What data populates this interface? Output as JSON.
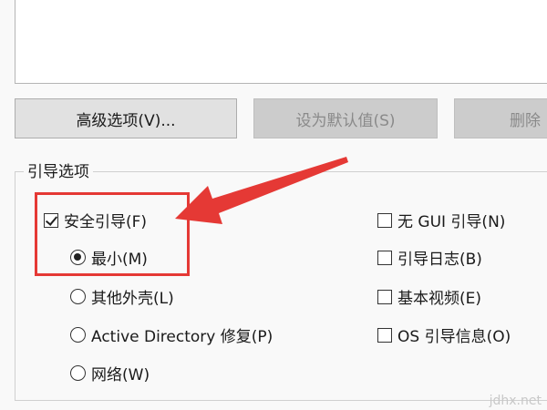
{
  "buttons": {
    "advanced": "高级选项(V)...",
    "set_default": "设为默认值(S)",
    "delete": "删除"
  },
  "boot_options": {
    "title": "引导选项",
    "safe_boot": {
      "label": "安全引导(F)",
      "checked": true
    },
    "minimal": {
      "label": "最小(M)",
      "selected": true
    },
    "alternate_shell": {
      "label": "其他外壳(L)",
      "selected": false
    },
    "ad_repair": {
      "label": "Active Directory 修复(P)",
      "selected": false
    },
    "network": {
      "label": "网络(W)",
      "selected": false
    },
    "no_gui_boot": {
      "label": "无 GUI 引导(N)",
      "checked": false
    },
    "boot_log": {
      "label": "引导日志(B)",
      "checked": false
    },
    "base_video": {
      "label": "基本视频(E)",
      "checked": false
    },
    "os_boot_info": {
      "label": "OS 引导信息(O)",
      "checked": false
    }
  },
  "annotation": {
    "color": "#e53935"
  },
  "watermark": "jdhx.net"
}
